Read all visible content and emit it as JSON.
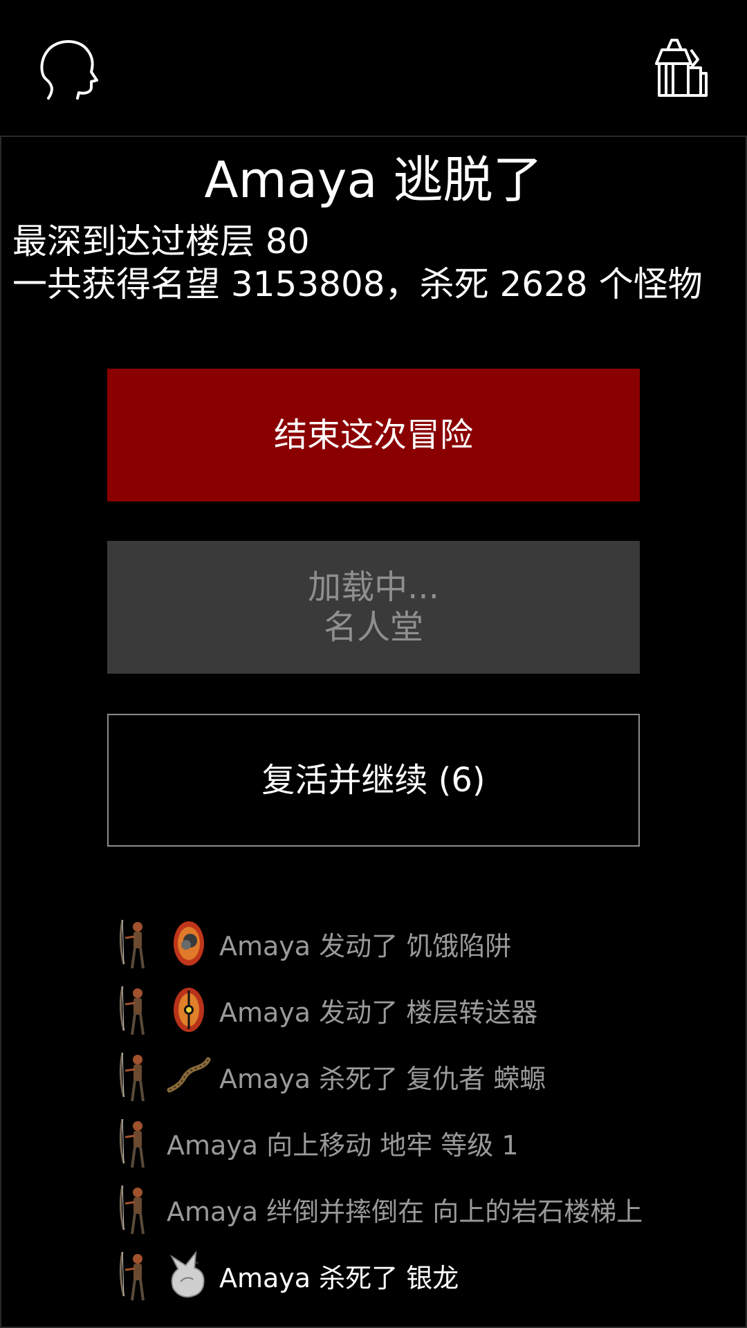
{
  "topbar": {
    "left_icon": "head-profile-icon",
    "right_icon": "hall-gifts-icon"
  },
  "result": {
    "title": "Amaya 逃脱了",
    "line1": "最深到达过楼层 80",
    "line2": "一共获得名望 3153808，杀死 2628 个怪物"
  },
  "buttons": {
    "end": "结束这次冒险",
    "hall_line1": "加载中...",
    "hall_line2": "名人堂",
    "revive": "复活并继续 (6)"
  },
  "colors": {
    "end_button": "#8a0000",
    "disabled_button": "#3a3a3a",
    "log_dim": "#9a9a9a"
  },
  "log": [
    {
      "text": "Amaya 发动了 饥饿陷阱",
      "icons": [
        "archer-icon",
        "hunger-trap-icon"
      ],
      "latest": false
    },
    {
      "text": "Amaya 发动了 楼层转送器",
      "icons": [
        "archer-icon",
        "teleporter-trap-icon"
      ],
      "latest": false
    },
    {
      "text": "Amaya 杀死了 复仇者 蝾螈",
      "icons": [
        "archer-icon",
        "salamander-icon"
      ],
      "latest": false
    },
    {
      "text": "Amaya 向上移动 地牢 等级 1",
      "icons": [
        "archer-icon"
      ],
      "latest": false
    },
    {
      "text": "Amaya 绊倒并摔倒在 向上的岩石楼梯上",
      "icons": [
        "archer-icon"
      ],
      "latest": false
    },
    {
      "text": "Amaya 杀死了 银龙",
      "icons": [
        "archer-icon",
        "silver-dragon-icon"
      ],
      "latest": true
    }
  ]
}
